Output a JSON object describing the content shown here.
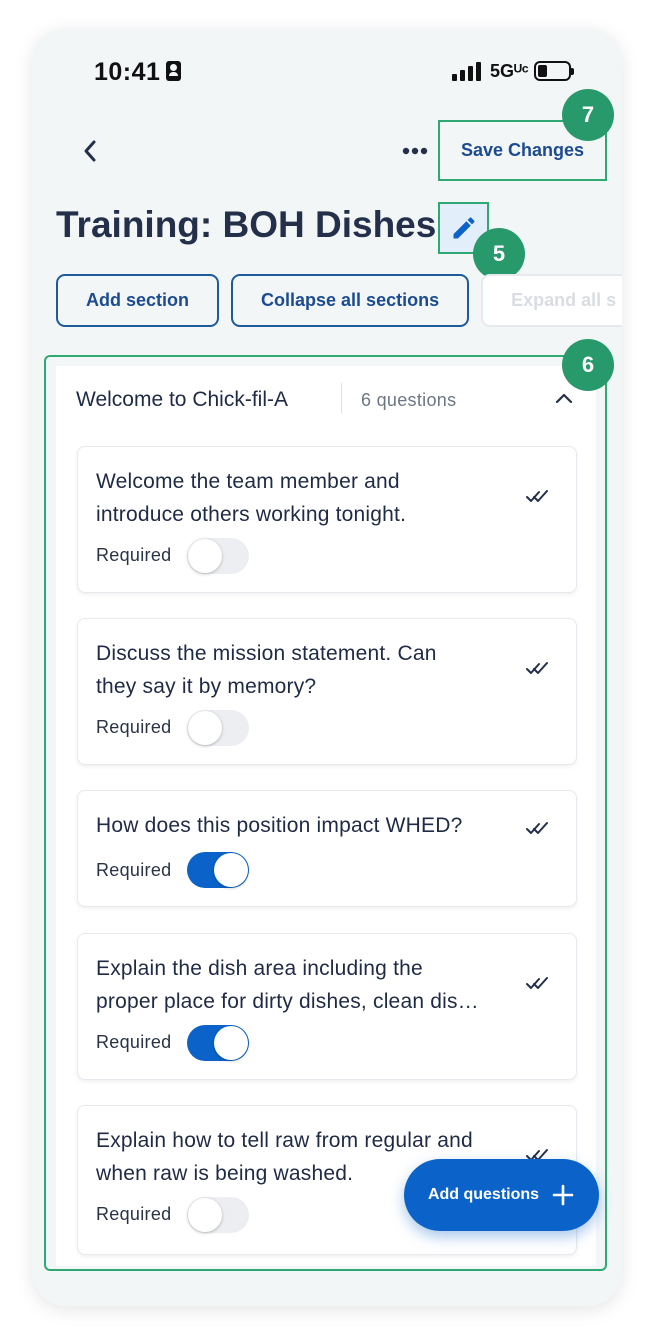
{
  "status_bar": {
    "time": "10:41",
    "network": "5Gᵁᶜ"
  },
  "header": {
    "save_label": "Save Changes",
    "title": "Training: BOH Dishes",
    "more_label": "•••"
  },
  "annotations": {
    "badge_7": "7",
    "badge_5": "5",
    "badge_6": "6"
  },
  "actions": {
    "add_section": "Add section",
    "collapse_all": "Collapse all sections",
    "expand_all": "Expand all s"
  },
  "section": {
    "name": "Welcome to Chick-fil-A",
    "count": "6 questions",
    "questions": [
      {
        "text_l1": "Welcome the team member and",
        "text_l2": "introduce others working tonight.",
        "required_label": "Required",
        "required": false
      },
      {
        "text_l1": "Discuss the mission statement.  Can",
        "text_l2": "they say it by memory?",
        "required_label": "Required",
        "required": false
      },
      {
        "text_l1": "How does this position impact WHED?",
        "text_l2": "",
        "required_label": "Required",
        "required": true
      },
      {
        "text_l1": "Explain the dish area including the",
        "text_l2": "proper place for dirty dishes, clean dis…",
        "required_label": "Required",
        "required": true
      },
      {
        "text_l1": "Explain how to tell raw from regular and",
        "text_l2": "when raw is being washed.",
        "required_label": "Required",
        "required": false
      }
    ]
  },
  "fab": {
    "label": "Add questions"
  },
  "colors": {
    "accent": "#0b63c9",
    "highlight": "#2fa874",
    "badge": "#27996b",
    "title": "#24304a"
  }
}
